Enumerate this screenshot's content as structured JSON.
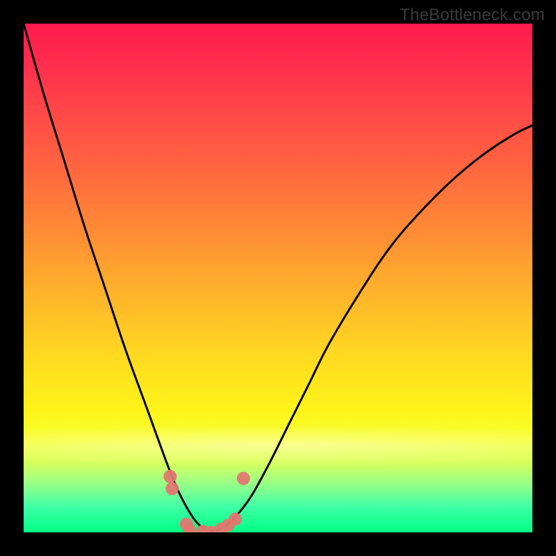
{
  "watermark": "TheBottleneck.com",
  "chart_data": {
    "type": "line",
    "title": "",
    "xlabel": "",
    "ylabel": "",
    "xlim": [
      0,
      100
    ],
    "ylim": [
      0,
      100
    ],
    "series": [
      {
        "name": "curve",
        "x": [
          0,
          4,
          8,
          12,
          16,
          20,
          24,
          28,
          30,
          32,
          34,
          36,
          38,
          40,
          44,
          48,
          52,
          56,
          60,
          66,
          72,
          78,
          84,
          90,
          96,
          100
        ],
        "y": [
          100,
          86,
          73,
          60,
          48,
          36,
          25,
          14,
          9,
          5,
          2,
          0.5,
          0.5,
          1.5,
          6,
          13,
          21,
          29,
          37,
          47,
          56,
          63,
          69,
          74,
          78,
          80
        ]
      }
    ],
    "markers": [
      {
        "x": 28.8,
        "y": 11.0
      },
      {
        "x": 29.2,
        "y": 8.6
      },
      {
        "x": 32.0,
        "y": 1.6
      },
      {
        "x": 32.6,
        "y": 0.5
      },
      {
        "x": 35.2,
        "y": 0.2
      },
      {
        "x": 36.8,
        "y": 0.0
      },
      {
        "x": 38.8,
        "y": 0.6
      },
      {
        "x": 40.2,
        "y": 1.4
      },
      {
        "x": 41.6,
        "y": 2.6
      },
      {
        "x": 43.2,
        "y": 10.6
      }
    ],
    "grid": false,
    "legend": false
  }
}
